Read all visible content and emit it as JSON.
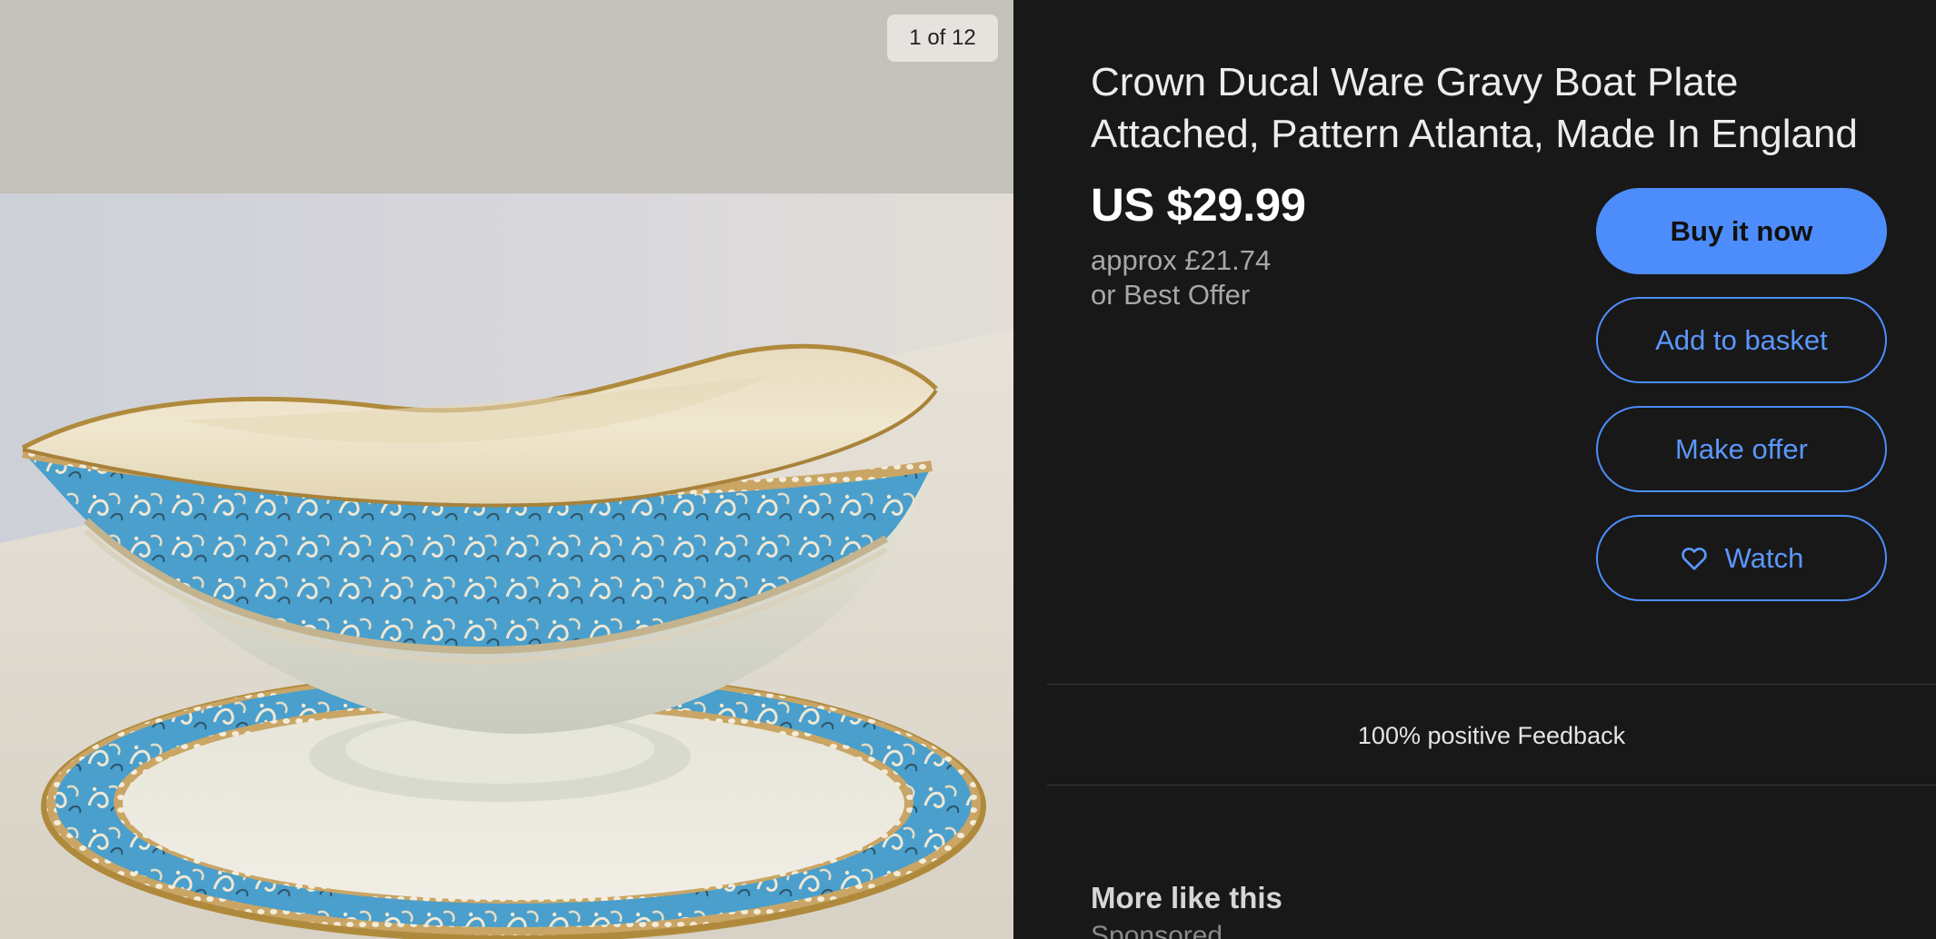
{
  "gallery": {
    "counter": "1 of 12",
    "image_subject": "gravy-boat-photo"
  },
  "listing": {
    "title": "Crown Ducal Ware Gravy Boat Plate Attached, Pattern Atlanta, Made In England",
    "price": "US $29.99",
    "approx_price": "approx £21.74",
    "best_offer": "or Best Offer"
  },
  "actions": {
    "buy_now": "Buy it now",
    "add_to_basket": "Add to basket",
    "make_offer": "Make offer",
    "watch": "Watch",
    "watch_icon": "heart-icon"
  },
  "seller": {
    "feedback": "100% positive Feedback"
  },
  "more": {
    "heading": "More like this",
    "sponsored": "Sponsored"
  },
  "colors": {
    "background": "#181818",
    "accent": "#4d8dfb",
    "pattern_blue": "#4a9fcc",
    "porcelain": "#eceadb",
    "gold_rim": "#b08a3c"
  }
}
